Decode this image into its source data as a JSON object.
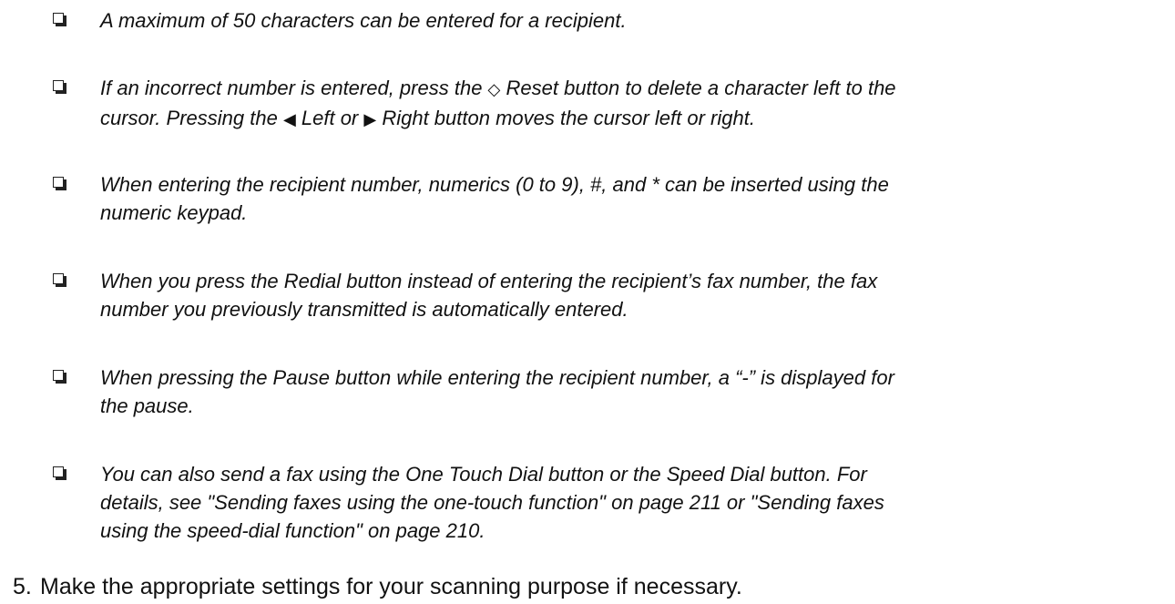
{
  "notes": [
    {
      "lines": [
        "A maximum of 50 characters can be entered for a recipient."
      ]
    },
    {
      "line1_pre": "If an incorrect number is entered, press the ",
      "reset_glyph": "◇",
      "line1_post": " Reset button to delete a character left to the",
      "line2_pre": "cursor. Pressing the ",
      "left_glyph": "◀",
      "line2_mid": " Left or ",
      "right_glyph": "▶",
      "line2_post": " Right button moves the cursor left or right."
    },
    {
      "lines": [
        "When entering the recipient number, numerics (0 to 9), #, and * can be inserted using the",
        "numeric keypad."
      ]
    },
    {
      "lines": [
        "When you press the Redial button instead of entering the recipient’s fax number, the fax",
        "number you previously transmitted is automatically entered."
      ]
    },
    {
      "lines": [
        "When pressing the Pause button while entering the recipient number, a “-” is displayed for",
        "the pause."
      ]
    },
    {
      "lines": [
        "You can also send a fax using the One Touch Dial button or the Speed Dial button. For",
        "details, see \"Sending faxes using the one-touch function\" on page 211 or \"Sending faxes",
        "using the speed-dial function\" on page 210."
      ]
    }
  ],
  "step": {
    "number": "5.",
    "text": "Make the appropriate settings for your scanning purpose if necessary."
  }
}
